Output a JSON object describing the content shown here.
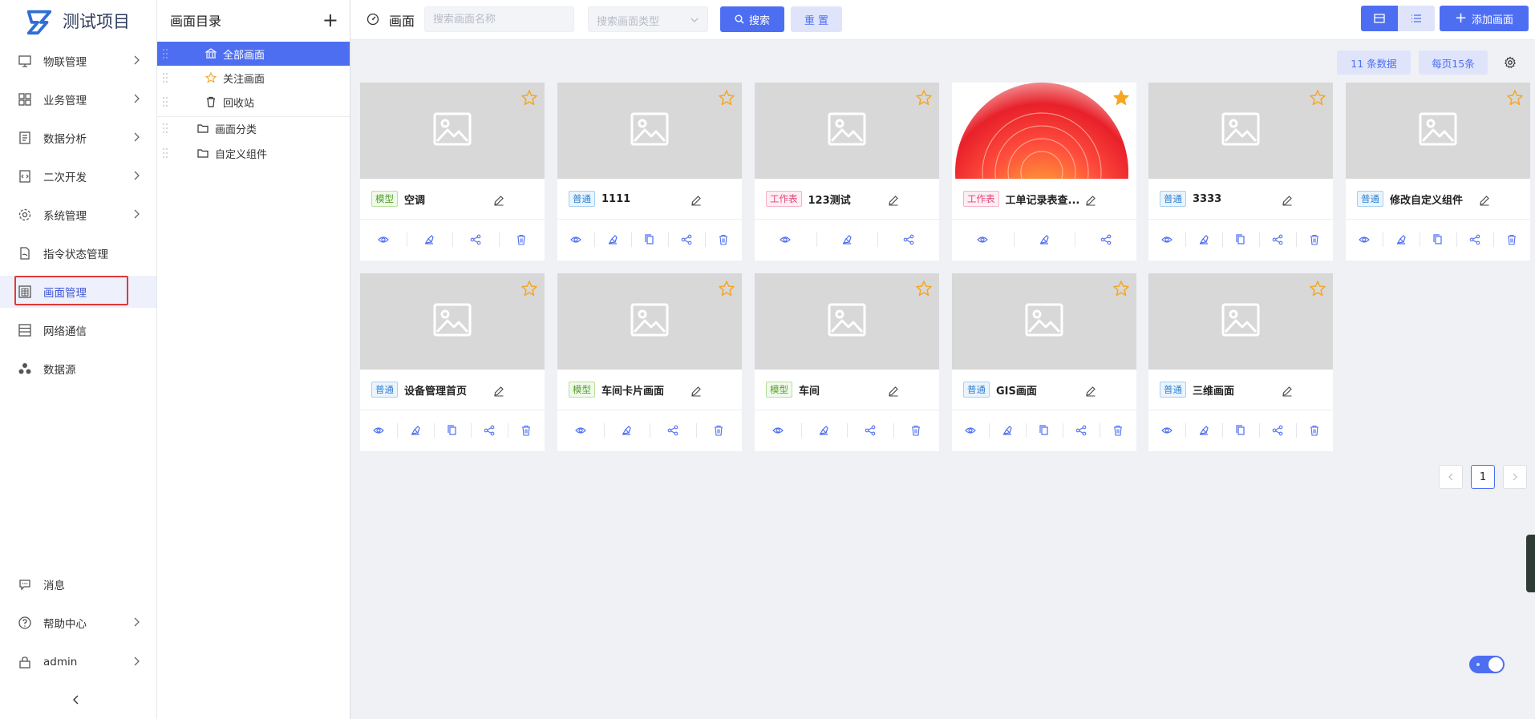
{
  "app": {
    "title": "测试项目"
  },
  "nav": {
    "items": [
      {
        "label": "物联管理",
        "icon": "monitor-icon",
        "has_arrow": true
      },
      {
        "label": "业务管理",
        "icon": "grid-icon",
        "has_arrow": true
      },
      {
        "label": "数据分析",
        "icon": "report-icon",
        "has_arrow": true
      },
      {
        "label": "二次开发",
        "icon": "code-icon",
        "has_arrow": true
      },
      {
        "label": "系统管理",
        "icon": "gear-icon",
        "has_arrow": true
      },
      {
        "label": "指令状态管理",
        "icon": "file-icon",
        "has_arrow": false
      },
      {
        "label": "画面管理",
        "icon": "screen-icon",
        "has_arrow": false,
        "active": true
      },
      {
        "label": "网络通信",
        "icon": "list-icon",
        "has_arrow": false
      },
      {
        "label": "数据源",
        "icon": "nodes-icon",
        "has_arrow": false
      }
    ],
    "bottom": [
      {
        "label": "消息",
        "icon": "message-icon",
        "has_arrow": false
      },
      {
        "label": "帮助中心",
        "icon": "help-icon",
        "has_arrow": true
      },
      {
        "label": "admin",
        "icon": "lock-icon",
        "has_arrow": true
      }
    ]
  },
  "tree": {
    "title": "画面目录",
    "items": [
      {
        "label": "全部画面",
        "icon": "bank-icon",
        "selected": true
      },
      {
        "label": "关注画面",
        "icon": "star-icon"
      },
      {
        "label": "回收站",
        "icon": "trash-icon"
      },
      {
        "label": "画面分类",
        "icon": "folder-icon"
      },
      {
        "label": "自定义组件",
        "icon": "folder-icon"
      }
    ]
  },
  "topbar": {
    "title": "画面",
    "search_placeholder": "搜索画面名称",
    "type_placeholder": "搜索画面类型",
    "search_label": "搜索",
    "reset_label": "重 置",
    "add_label": "添加画面"
  },
  "info": {
    "count": "11 条数据",
    "page_size": "每页15条"
  },
  "colors": {
    "accent": "#4e6ef2",
    "star": "#f5a623",
    "active_border": "#e03a3a"
  },
  "cards": [
    {
      "tag": "模型",
      "tag_type": "model",
      "name": "空调",
      "starred": false,
      "has_copy": false,
      "has_image": false
    },
    {
      "tag": "普通",
      "tag_type": "normal",
      "name": "1111",
      "starred": false,
      "has_copy": true,
      "has_image": false
    },
    {
      "tag": "工作表",
      "tag_type": "sheet",
      "name": "123测试",
      "starred": false,
      "has_copy": false,
      "has_image": false,
      "no_delete": true
    },
    {
      "tag": "工作表",
      "tag_type": "sheet",
      "name": "工单记录表查...",
      "starred": true,
      "has_copy": false,
      "has_image": true,
      "no_delete": true
    },
    {
      "tag": "普通",
      "tag_type": "normal",
      "name": "3333",
      "starred": false,
      "has_copy": true,
      "has_image": false
    },
    {
      "tag": "普通",
      "tag_type": "normal",
      "name": "修改自定义组件",
      "starred": false,
      "has_copy": true,
      "has_image": false
    },
    {
      "tag": "普通",
      "tag_type": "normal",
      "name": "设备管理首页",
      "starred": false,
      "has_copy": true,
      "has_image": false
    },
    {
      "tag": "模型",
      "tag_type": "model",
      "name": "车间卡片画面",
      "starred": false,
      "has_copy": false,
      "has_image": false
    },
    {
      "tag": "模型",
      "tag_type": "model",
      "name": "车间",
      "starred": false,
      "has_copy": false,
      "has_image": false
    },
    {
      "tag": "普通",
      "tag_type": "normal",
      "name": "GIS画面",
      "starred": false,
      "has_copy": true,
      "has_image": false
    },
    {
      "tag": "普通",
      "tag_type": "normal",
      "name": "三维画面",
      "starred": false,
      "has_copy": true,
      "has_image": false
    }
  ],
  "pagination": {
    "current": "1"
  }
}
